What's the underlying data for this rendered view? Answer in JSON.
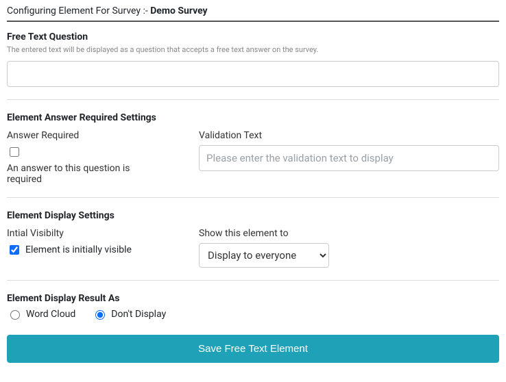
{
  "header": {
    "prefix": "Configuring Element For Survey :- ",
    "survey_name": "Demo Survey"
  },
  "free_text": {
    "heading": "Free Text Question",
    "helper": "The entered text will be displayed as a question that accepts a free text answer on the survey.",
    "value": ""
  },
  "answer_required": {
    "heading": "Element Answer Required Settings",
    "label": "Answer Required",
    "checked": false,
    "hint": "An answer to this question is required",
    "validation_label": "Validation Text",
    "validation_placeholder": "Please enter the validation text to display",
    "validation_value": ""
  },
  "display": {
    "heading": "Element Display Settings",
    "visibility_label": "Intial Visibilty",
    "visibility_checked": true,
    "visibility_text": "Element is initially visible",
    "show_to_label": "Show this element to",
    "show_to_selected": "Display to everyone",
    "show_to_options": [
      "Display to everyone"
    ]
  },
  "result_as": {
    "heading": "Element Display Result As",
    "options": [
      {
        "label": "Word Cloud",
        "value": "wordcloud",
        "checked": false
      },
      {
        "label": "Don't Display",
        "value": "dontdisplay",
        "checked": true
      }
    ]
  },
  "save_label": "Save Free Text Element"
}
